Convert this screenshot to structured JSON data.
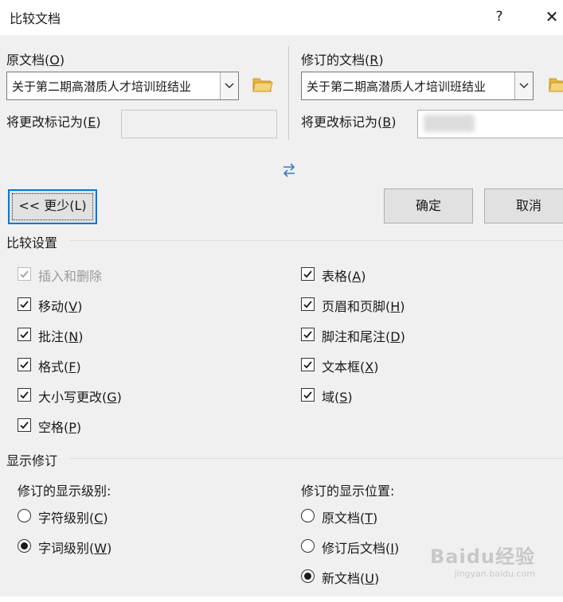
{
  "window": {
    "title": "比较文档",
    "help_label": "?",
    "close_label": "✕"
  },
  "original": {
    "label": "原文档(",
    "hotkey": "O",
    "label_end": ")",
    "value": "关于第二期高潜质人才培训班结业",
    "mark_label": "将更改标记为(",
    "mark_hotkey": "E",
    "mark_label_end": ")",
    "mark_value": ""
  },
  "revised": {
    "label": "修订的文档(",
    "hotkey": "R",
    "label_end": ")",
    "value": "关于第二期高潜质人才培训班结业",
    "mark_label": "将更改标记为(",
    "mark_hotkey": "B",
    "mark_label_end": ")",
    "mark_value": ""
  },
  "buttons": {
    "less": "<< 更少(L)",
    "ok": "确定",
    "cancel": "取消"
  },
  "compare_settings": {
    "title": "比较设置",
    "left": [
      {
        "label": "插入和删除",
        "hotkey": "",
        "checked": true,
        "disabled": true
      },
      {
        "label": "移动(",
        "hotkey": "V",
        "end": ")",
        "checked": true
      },
      {
        "label": "批注(",
        "hotkey": "N",
        "end": ")",
        "checked": true
      },
      {
        "label": "格式(",
        "hotkey": "F",
        "end": ")",
        "checked": true
      },
      {
        "label": "大小写更改(",
        "hotkey": "G",
        "end": ")",
        "checked": true
      },
      {
        "label": "空格(",
        "hotkey": "P",
        "end": ")",
        "checked": true
      }
    ],
    "right": [
      {
        "label": "表格(",
        "hotkey": "A",
        "end": ")",
        "checked": true
      },
      {
        "label": "页眉和页脚(",
        "hotkey": "H",
        "end": ")",
        "checked": true
      },
      {
        "label": "脚注和尾注(",
        "hotkey": "D",
        "end": ")",
        "checked": true
      },
      {
        "label": "文本框(",
        "hotkey": "X",
        "end": ")",
        "checked": true
      },
      {
        "label": "域(",
        "hotkey": "S",
        "end": ")",
        "checked": true
      }
    ]
  },
  "show_changes": {
    "title": "显示修订",
    "level_title": "修订的显示级别:",
    "level_options": [
      {
        "label": "字符级别(",
        "hotkey": "C",
        "end": ")",
        "selected": false
      },
      {
        "label": "字词级别(",
        "hotkey": "W",
        "end": ")",
        "selected": true
      }
    ],
    "position_title": "修订的显示位置:",
    "position_options": [
      {
        "label": "原文档(",
        "hotkey": "T",
        "end": ")",
        "selected": false
      },
      {
        "label": "修订后文档(",
        "hotkey": "I",
        "end": ")",
        "selected": false
      },
      {
        "label": "新文档(",
        "hotkey": "U",
        "end": ")",
        "selected": true
      }
    ]
  },
  "watermark": {
    "text": "Baidu经验",
    "sub": "jingyan.baidu.com"
  },
  "colors": {
    "accent": "#0078d7",
    "folder": "#e8b73c"
  }
}
